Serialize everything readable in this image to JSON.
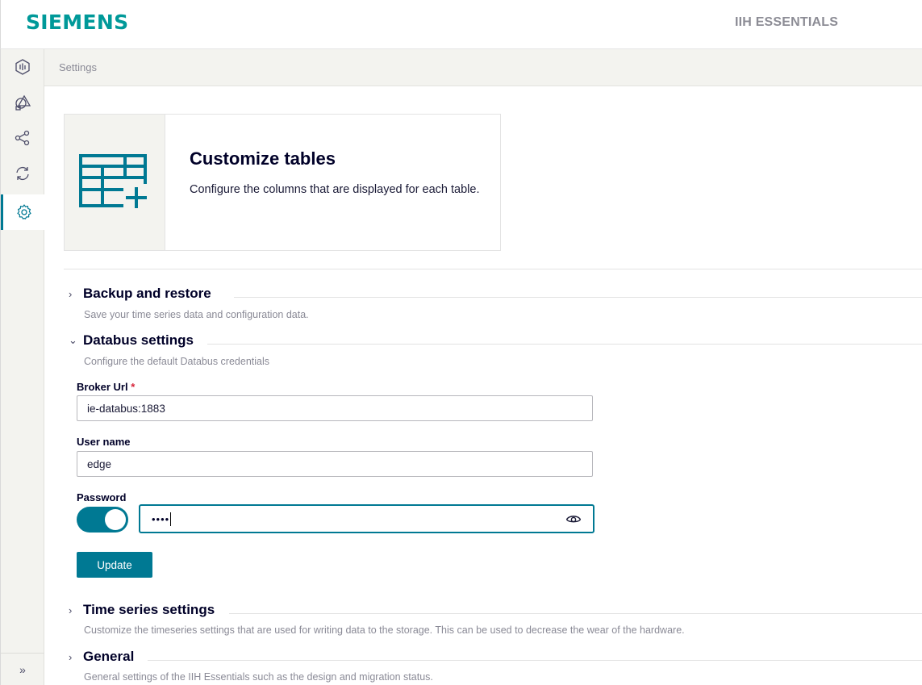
{
  "header": {
    "logo": "SIEMENS",
    "app_name": "IIH ESSENTIALS"
  },
  "sidebar": {
    "items": [
      {
        "name": "dashboard",
        "icon": "hexagon-bars-icon"
      },
      {
        "name": "shapes",
        "icon": "shapes-icon"
      },
      {
        "name": "connections",
        "icon": "share-icon"
      },
      {
        "name": "sync",
        "icon": "refresh-icon"
      },
      {
        "name": "settings",
        "icon": "gear-icon",
        "active": true
      }
    ],
    "expand_glyph": "»"
  },
  "breadcrumb": "Settings",
  "card": {
    "title": "Customize tables",
    "description": "Configure the columns that are displayed for each table."
  },
  "sections": {
    "backup": {
      "chevron": "›",
      "title": "Backup and restore",
      "description": "Save your time series data and configuration data."
    },
    "databus": {
      "chevron": "⌄",
      "title": "Databus settings",
      "description": "Configure the default Databus credentials"
    },
    "timeseries": {
      "chevron": "›",
      "title": "Time series settings",
      "description": "Customize the timeseries settings that are used for writing data to the storage. This can be used to decrease the wear of the hardware."
    },
    "general": {
      "chevron": "›",
      "title": "General",
      "description": "General settings of the IIH Essentials such as the design and migration status."
    }
  },
  "form": {
    "broker_url_label": "Broker Url",
    "required_marker": "*",
    "broker_url_value": "ie-databus:1883",
    "username_label": "User name",
    "username_value": "edge",
    "password_label": "Password",
    "password_masked": "••••",
    "toggle_on": true,
    "update_label": "Update"
  },
  "colors": {
    "brand": "#009999",
    "accent": "#007993",
    "required": "#d72339"
  }
}
